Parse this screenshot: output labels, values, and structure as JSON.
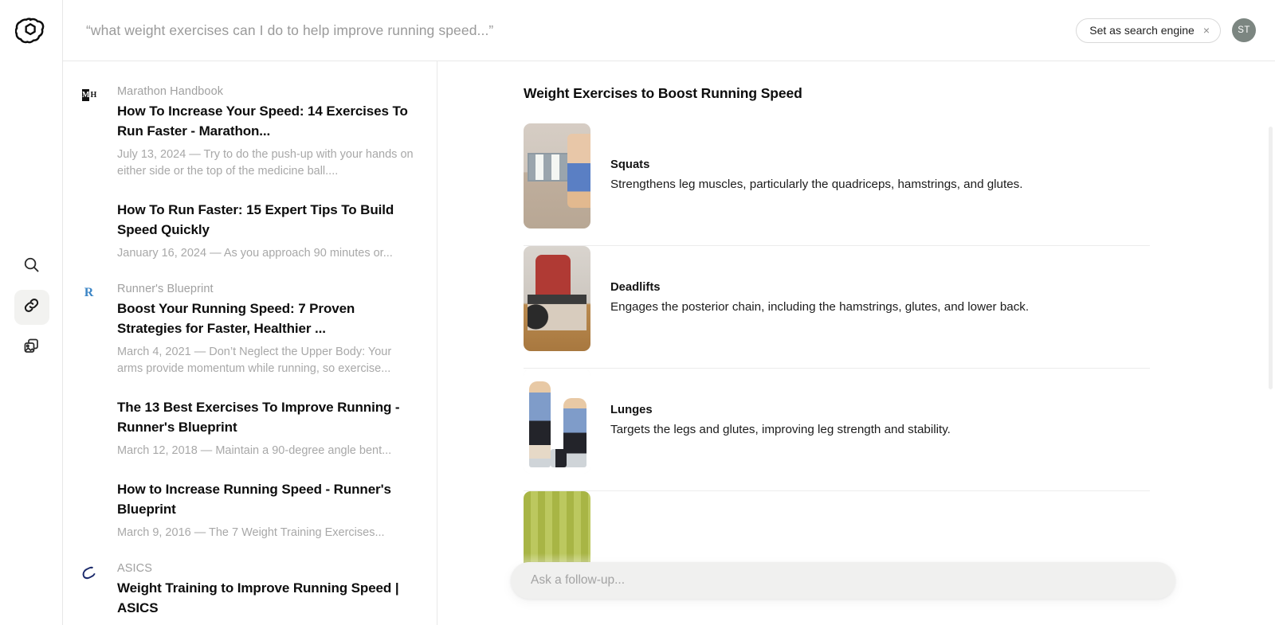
{
  "brand": {
    "logo_name": "openai-logo"
  },
  "header": {
    "query": "“what weight exercises can I do to help improve running speed...”",
    "pill_label": "Set as search engine",
    "pill_close": "×",
    "avatar_initials": "ST"
  },
  "rail": {
    "items": [
      {
        "name": "search-icon",
        "label": "Search",
        "active": false
      },
      {
        "name": "link-icon",
        "label": "Links",
        "active": true
      },
      {
        "name": "images-icon",
        "label": "Images",
        "active": false
      }
    ]
  },
  "results": {
    "groups": [
      {
        "source": "Marathon Handbook",
        "favicon": "marathon-handbook-favicon",
        "items": [
          {
            "title": "How To Increase Your Speed: 14 Exercises To Run Faster - Marathon...",
            "snippet": "July 13, 2024 — Try to do the push-up with your hands on either side or the top of the medicine ball...."
          },
          {
            "title": "How To Run Faster: 15 Expert Tips To Build Speed Quickly",
            "snippet": "January 16, 2024 — As you approach 90 minutes or..."
          }
        ]
      },
      {
        "source": "Runner's Blueprint",
        "favicon": "runners-blueprint-favicon",
        "items": [
          {
            "title": "Boost Your Running Speed: 7 Proven Strategies for Faster, Healthier ...",
            "snippet": "March 4, 2021 — Don’t Neglect the Upper Body: Your arms provide momentum while running, so exercise..."
          },
          {
            "title": "The 13 Best Exercises To Improve Running - Runner's Blueprint",
            "snippet": "March 12, 2018 — Maintain a 90-degree angle bent..."
          },
          {
            "title": "How to Increase Running Speed - Runner's Blueprint",
            "snippet": "March 9, 2016 — The 7 Weight Training Exercises..."
          }
        ]
      },
      {
        "source": "ASICS",
        "favicon": "asics-favicon",
        "items": [
          {
            "title": "Weight Training to Improve Running Speed | ASICS",
            "snippet": ""
          }
        ]
      }
    ]
  },
  "answer": {
    "title": "Weight Exercises to Boost Running Speed",
    "exercises": [
      {
        "name": "Squats",
        "description": "Strengthens leg muscles, particularly the quadriceps, hamstrings, and glutes.",
        "thumb": "squats-thumbnail"
      },
      {
        "name": "Deadlifts",
        "description": "Engages the posterior chain, including the hamstrings, glutes, and lower back.",
        "thumb": "deadlifts-thumbnail"
      },
      {
        "name": "Lunges",
        "description": "Targets the legs and glutes, improving leg strength and stability.",
        "thumb": "lunges-thumbnail"
      },
      {
        "name": "",
        "description": "",
        "thumb": "fourth-exercise-thumbnail"
      }
    ]
  },
  "followup": {
    "placeholder": "Ask a follow-up..."
  },
  "colors": {
    "accent_link": "#3d86c6",
    "avatar_bg": "#7c8681",
    "border": "#e9e9e9",
    "muted_text": "#a0a0a0"
  }
}
